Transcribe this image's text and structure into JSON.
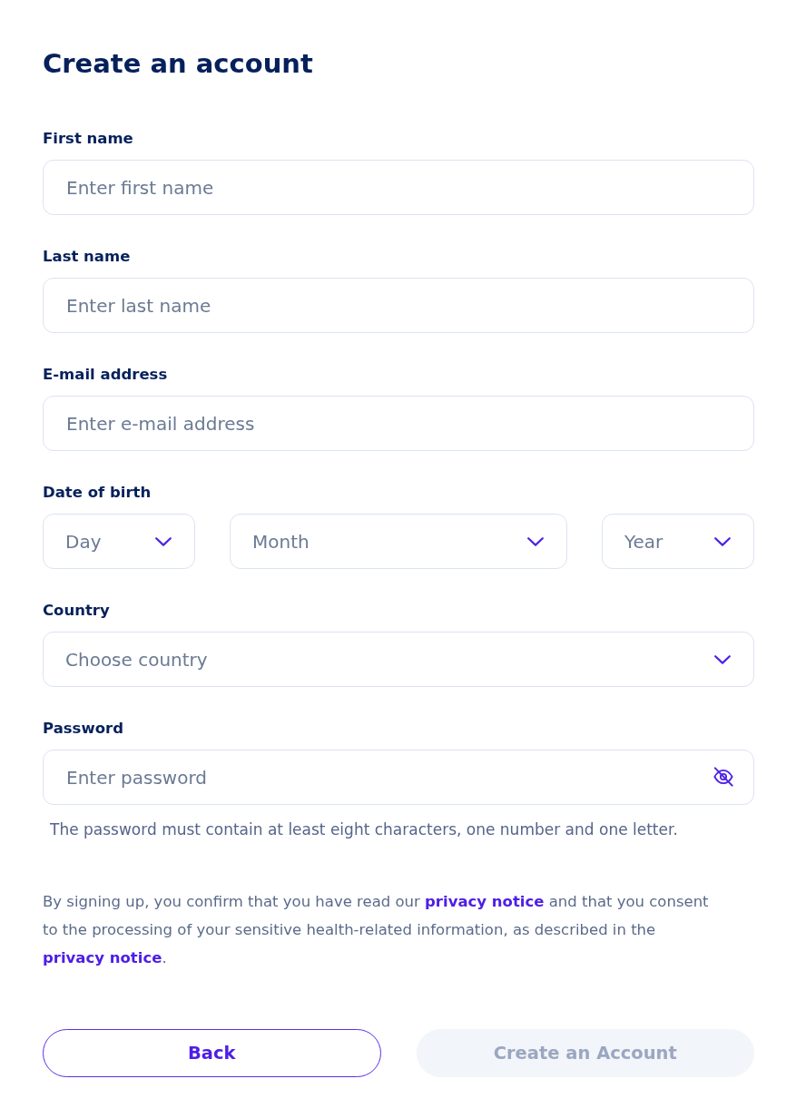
{
  "title": "Create an account",
  "fields": [
    {
      "kind": "text",
      "label": "First name",
      "placeholder": "Enter first name"
    },
    {
      "kind": "text",
      "label": "Last name",
      "placeholder": "Enter last name"
    },
    {
      "kind": "text",
      "label": "E-mail address",
      "placeholder": "Enter e-mail address"
    },
    {
      "kind": "date",
      "label": "Date of birth",
      "selects": [
        {
          "placeholder": "Day"
        },
        {
          "placeholder": "Month"
        },
        {
          "placeholder": "Year"
        }
      ]
    },
    {
      "kind": "select",
      "label": "Country",
      "placeholder": "Choose country"
    },
    {
      "kind": "password",
      "label": "Password",
      "placeholder": "Enter password",
      "revealed": false,
      "hint": "The password must contain at least eight characters, one number and one letter."
    }
  ],
  "consent": [
    {
      "kind": "text",
      "text": "By signing up, you confirm that you have read our "
    },
    {
      "kind": "link",
      "text": "privacy notice"
    },
    {
      "kind": "text",
      "text": " and that you consent to the processing of your sensitive health-related information, as described in the "
    },
    {
      "kind": "link",
      "text": "privacy notice"
    },
    {
      "kind": "text",
      "text": "."
    }
  ],
  "buttons": [
    {
      "kind": "secondary",
      "label": "Back",
      "disabled": false
    },
    {
      "kind": "primary",
      "label": "Create an Account",
      "disabled": true
    }
  ]
}
